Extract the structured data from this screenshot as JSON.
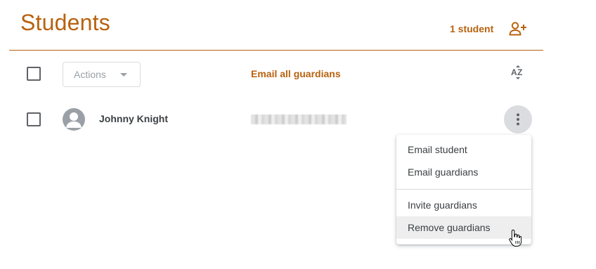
{
  "header": {
    "title": "Students",
    "student_count": "1 student",
    "add_student_icon": "person-add-icon"
  },
  "toolbar": {
    "actions_label": "Actions",
    "email_all_label": "Email all guardians",
    "sort_icon": "sort-az-icon"
  },
  "students": [
    {
      "name": "Johnny Knight",
      "email_visible": false
    }
  ],
  "menu": {
    "items": [
      {
        "label": "Email student"
      },
      {
        "label": "Email guardians"
      },
      {
        "label": "Invite guardians"
      },
      {
        "label": "Remove guardians"
      }
    ],
    "hovered_item": "Remove guardians"
  },
  "colors": {
    "accent": "#b8620f",
    "text": "#3c4043",
    "muted": "#9aa0a6",
    "divider": "#dadce0",
    "hover": "#eeeeee"
  }
}
